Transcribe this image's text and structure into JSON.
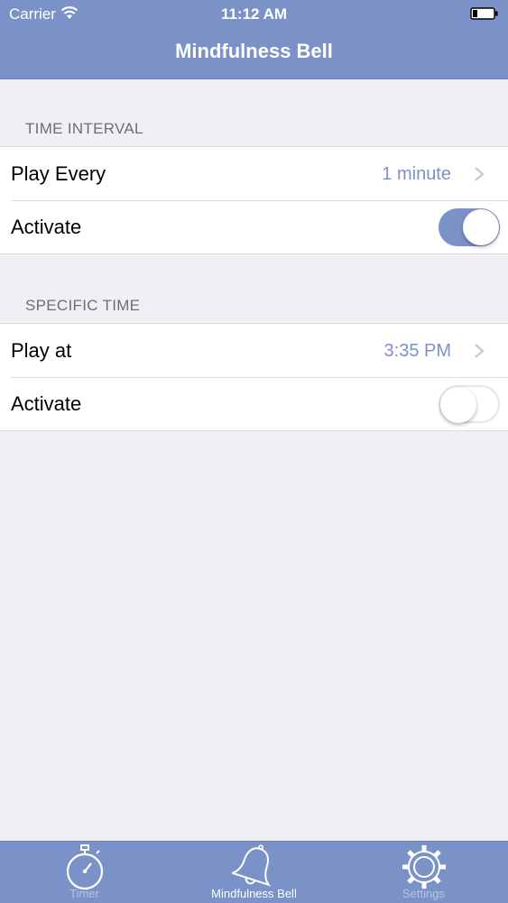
{
  "status_bar": {
    "carrier": "Carrier",
    "time": "11:12 AM"
  },
  "nav": {
    "title": "Mindfulness Bell"
  },
  "sections": [
    {
      "header": "TIME INTERVAL",
      "rows": [
        {
          "label": "Play Every",
          "value": "1 minute"
        },
        {
          "label": "Activate",
          "toggle_on": true
        }
      ]
    },
    {
      "header": "SPECIFIC TIME",
      "rows": [
        {
          "label": "Play at",
          "value": "3:35 PM"
        },
        {
          "label": "Activate",
          "toggle_on": false
        }
      ]
    }
  ],
  "tab_bar": {
    "tabs": [
      {
        "label": "Timer",
        "icon": "stopwatch-icon",
        "selected": false
      },
      {
        "label": "Mindfulness Bell",
        "icon": "bell-icon",
        "selected": true
      },
      {
        "label": "Settings",
        "icon": "gear-icon",
        "selected": false
      }
    ]
  },
  "colors": {
    "accent": "#7a92c8",
    "background": "#efeff4",
    "header_text": "#6d6d72"
  }
}
